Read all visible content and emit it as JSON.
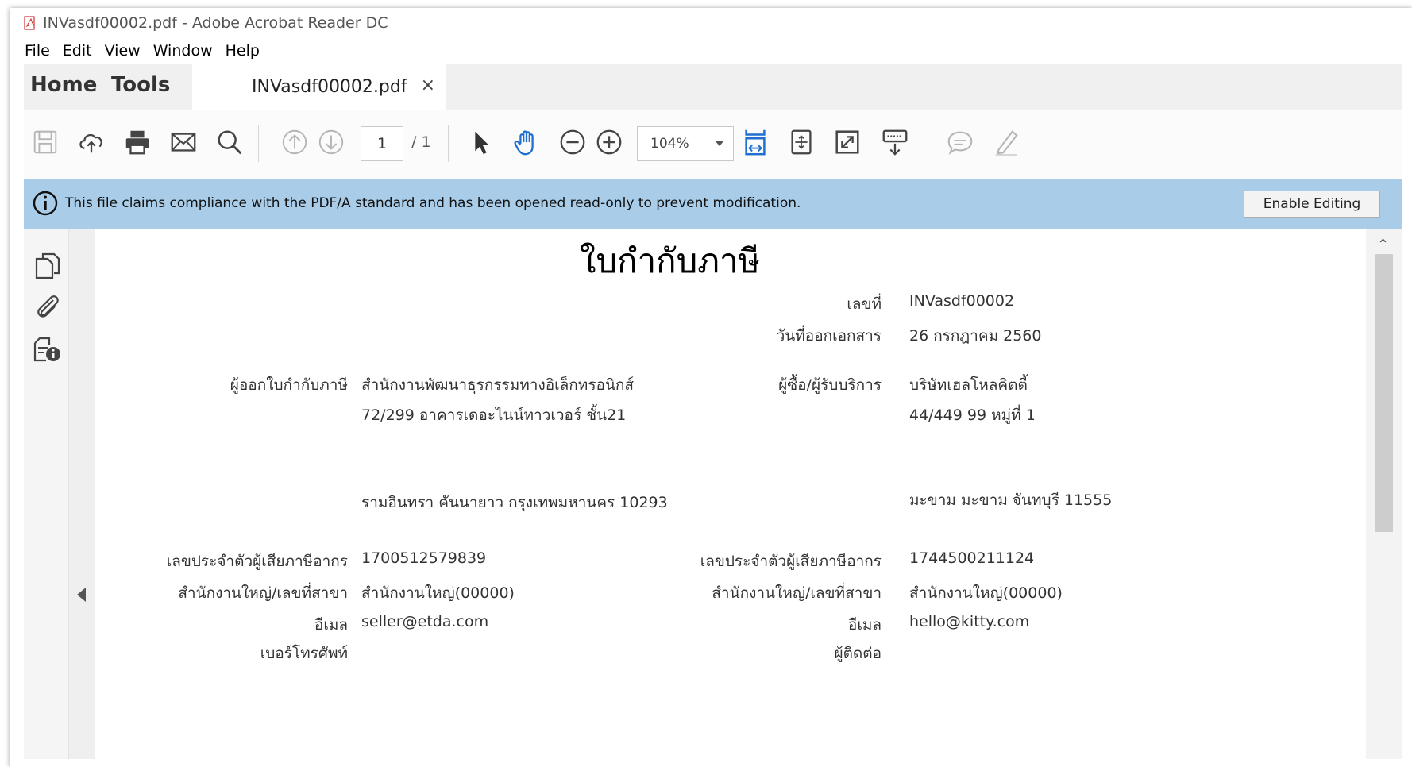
{
  "window": {
    "title": "INVasdf00002.pdf - Adobe Acrobat Reader DC"
  },
  "menu": [
    "File",
    "Edit",
    "View",
    "Window",
    "Help"
  ],
  "tabs": {
    "home": "Home",
    "tools": "Tools",
    "document": "INVasdf00002.pdf",
    "close": "×"
  },
  "toolbar": {
    "page_current": "1",
    "page_total": "/ 1",
    "zoom": "104%"
  },
  "infobar": {
    "message": "This file claims compliance with the PDF/A standard and has been opened read-only to prevent modification.",
    "button": "Enable Editing"
  },
  "document": {
    "title": "ใบกำกับภาษี",
    "number_label": "เลขที่",
    "number_value": "INVasdf00002",
    "date_label": "วันที่ออกเอกสาร",
    "date_value": "26 กรกฎาคม 2560",
    "seller": {
      "label": "ผู้ออกใบกำกับภาษี",
      "name": "สำนักงานพัฒนาธุรกรรมทางอิเล็กทรอนิกส์",
      "address1": "72/299  อาคารเดอะไนน์ทาวเวอร์ ชั้น21",
      "address2": "รามอินทรา คันนายาว กรุงเทพมหานคร 10293",
      "tax_label": "เลขประจำตัวผู้เสียภาษีอากร",
      "tax_value": "1700512579839",
      "branch_label": "สำนักงานใหญ่/เลขที่สาขา",
      "branch_value": "สำนักงานใหญ่(00000)",
      "email_label": "อีเมล",
      "email_value": "seller@etda.com",
      "phone_label": "เบอร์โทรศัพท์"
    },
    "buyer": {
      "label": "ผู้ซื้อ/ผู้รับบริการ",
      "name": "บริษัทเฮลโหลคิตตี้",
      "address1": "44/449 99 หมู่ที่ 1",
      "address2": "มะขาม มะขาม จันทบุรี 11555",
      "tax_label": "เลขประจำตัวผู้เสียภาษีอากร",
      "tax_value": "1744500211124",
      "branch_label": "สำนักงานใหญ่/เลขที่สาขา",
      "branch_value": "สำนักงานใหญ่(00000)",
      "email_label": "อีเมล",
      "email_value": "hello@kitty.com",
      "contact_label": "ผู้ติดต่อ"
    }
  },
  "colors": {
    "infobar_bg": "#a9cde8",
    "tab_bg": "#f0f0f0",
    "icon_blue": "#1f6fd1",
    "icon_gray": "#555555"
  }
}
